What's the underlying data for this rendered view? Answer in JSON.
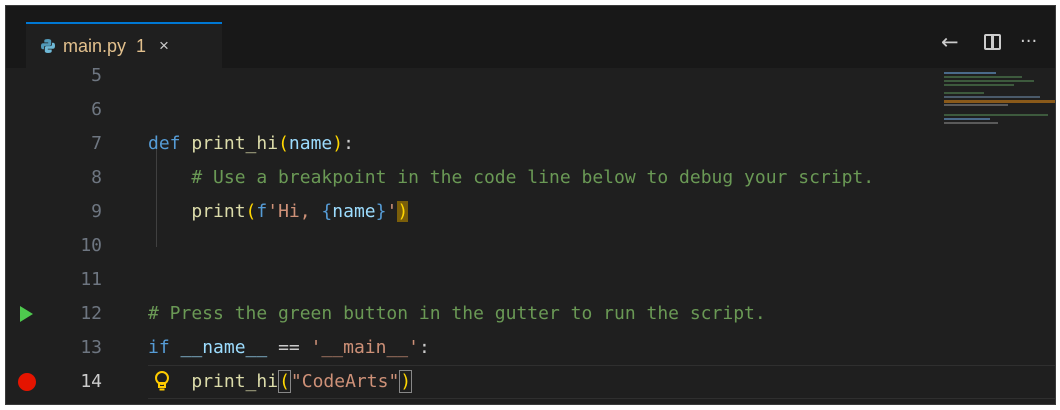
{
  "tab": {
    "file_name": "main.py",
    "problem_count": "1",
    "close_glyph": "×",
    "file_icon": "python-icon"
  },
  "actions": {
    "back_glyph": "←",
    "more_glyph": "···",
    "split_icon": "split-editor-icon"
  },
  "lines": [
    {
      "n": "5"
    },
    {
      "n": "6"
    },
    {
      "n": "7",
      "def": "def",
      "func": "print_hi",
      "open": "(",
      "param": "name",
      "close": ")",
      "colon": ":"
    },
    {
      "n": "8",
      "comment": "# Use a breakpoint in the code line below to debug your script."
    },
    {
      "n": "9",
      "func": "print",
      "open": "(",
      "fprefix": "f",
      "str1": "'Hi, ",
      "lbrace": "{",
      "var": "name",
      "rbrace": "}",
      "str2": "'",
      "close": ")"
    },
    {
      "n": "10"
    },
    {
      "n": "11"
    },
    {
      "n": "12",
      "comment": "# Press the green button in the gutter to run the script."
    },
    {
      "n": "13",
      "kw": "if",
      "dunder": "__name__",
      "op": " == ",
      "str": "'__main__'",
      "colon": ":"
    },
    {
      "n": "14",
      "func": "print_hi",
      "open": "(",
      "str": "\"CodeArts\"",
      "close": ")"
    }
  ],
  "colors": {
    "editor_bg": "#1f1f1f",
    "tab_accent": "#0078d4",
    "run_green": "#4ec94e",
    "breakpoint_red": "#e51400",
    "warning_yellow": "#e2c08d"
  }
}
